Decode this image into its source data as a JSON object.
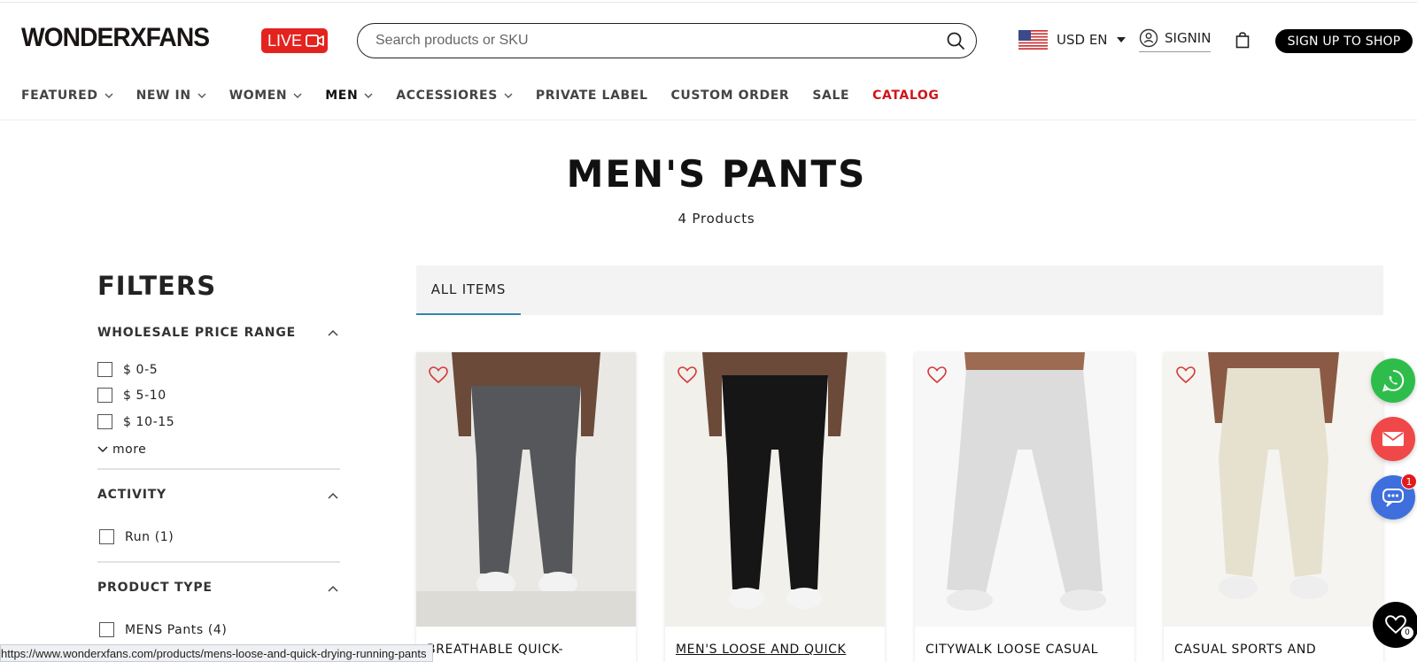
{
  "brand": {
    "logo_text": "WONDERXFANS",
    "live_label": "LIVE"
  },
  "search": {
    "placeholder": "Search products or SKU",
    "value": ""
  },
  "header": {
    "currency_label": "USD EN",
    "signin_label": "SIGNIN",
    "signup_label": "SIGN UP TO SHOP"
  },
  "nav": {
    "items": [
      {
        "label": "FEATURED",
        "dropdown": true
      },
      {
        "label": "NEW IN",
        "dropdown": true
      },
      {
        "label": "WOMEN",
        "dropdown": true
      },
      {
        "label": "MEN",
        "dropdown": true,
        "active": true
      },
      {
        "label": "ACCESSIORES",
        "dropdown": true
      },
      {
        "label": "PRIVATE LABEL",
        "dropdown": false
      },
      {
        "label": "CUSTOM ORDER",
        "dropdown": false
      },
      {
        "label": "SALE",
        "dropdown": false
      },
      {
        "label": "CATALOG",
        "dropdown": false,
        "color": "#d0151b"
      }
    ]
  },
  "page": {
    "title": "MEN'S PANTS",
    "count": "4 Products"
  },
  "filters": {
    "title": "FILTERS",
    "sections": [
      {
        "title": "WHOLESALE PRICE RANGE",
        "options": [
          "$ 0-5",
          "$ 5-10",
          "$ 10-15"
        ],
        "more_label": "more"
      },
      {
        "title": "ACTIVITY",
        "options": [
          "Run (1)"
        ]
      },
      {
        "title": "PRODUCT TYPE",
        "options": [
          "MENS Pants (4)"
        ]
      }
    ]
  },
  "tabs": {
    "active_label": "ALL ITEMS"
  },
  "products": [
    {
      "name": "BREATHABLE QUICK-",
      "pant_color": "#56575a",
      "bg": "#e9e8e4"
    },
    {
      "name": "MEN'S LOOSE AND QUICK",
      "pant_color": "#161616",
      "bg": "#f1f0eb"
    },
    {
      "name": "CITYWALK LOOSE CASUAL",
      "pant_color": "#dcdcdc",
      "bg": "#f7f7f7"
    },
    {
      "name": "CASUAL SPORTS AND",
      "pant_color": "#e6e1cf",
      "bg": "#f5f4f0"
    }
  ],
  "floating": {
    "chat_badge": "1",
    "wishlist_count": "0"
  },
  "status_url": "https://www.wonderxfans.com/products/mens-loose-and-quick-drying-running-pants",
  "colors": {
    "accent_red": "#e4231f",
    "tab_underline": "#2e86b0",
    "whatsapp": "#2ebd4b",
    "email": "#f04848",
    "chat": "#3f6fdd"
  }
}
